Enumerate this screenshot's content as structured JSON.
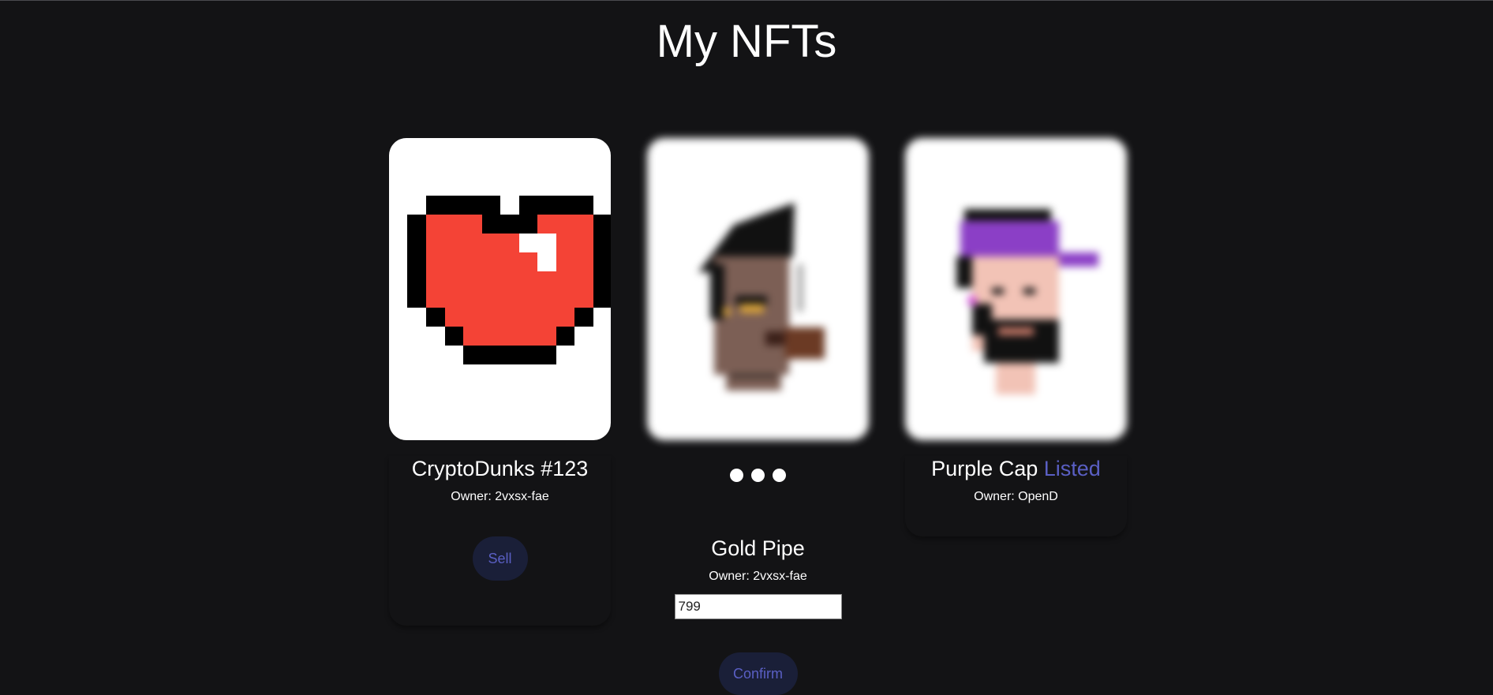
{
  "page": {
    "title": "My NFTs"
  },
  "nfts": [
    {
      "name": "CryptoDunks #123",
      "owner_label": "Owner: 2vxsx-fae",
      "image_icon": "pixel-heart-icon",
      "action_label": "Sell"
    },
    {
      "name": "Gold Pipe",
      "owner_label": "Owner: 2vxsx-fae",
      "image_icon": "pipe-punk-icon",
      "loading": true,
      "price_value": "799",
      "action_label": "Confirm"
    },
    {
      "name": "Purple Cap",
      "status": "Listed",
      "owner_label": "Owner: OpenD",
      "image_icon": "purple-cap-punk-icon"
    }
  ],
  "colors": {
    "background": "#131315",
    "card": "#ffffff",
    "accent": "#5a5fc4",
    "button_bg": "#1a1f38",
    "heart_red": "#f44336"
  }
}
